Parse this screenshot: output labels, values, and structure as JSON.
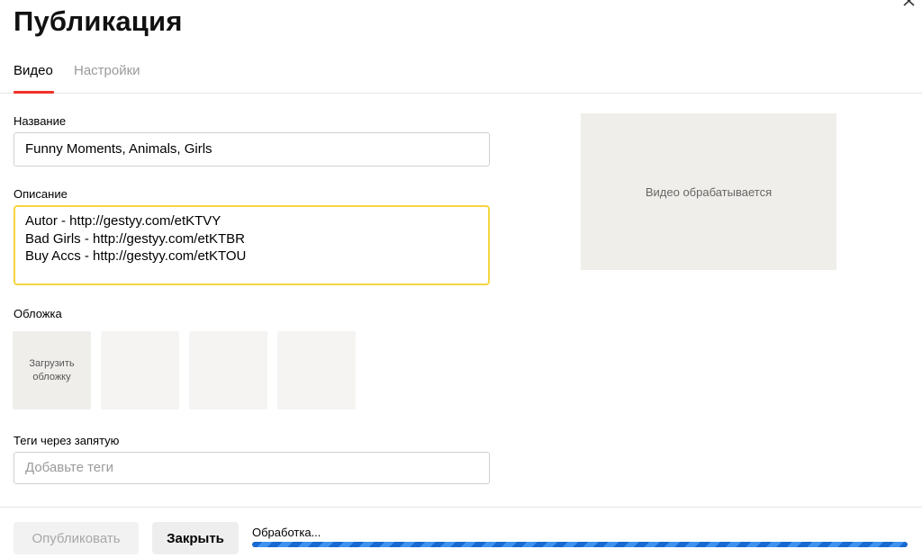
{
  "dialog": {
    "title": "Публикация",
    "close_icon": "close-x-icon"
  },
  "tabs": [
    {
      "label": "Видео",
      "active": true
    },
    {
      "label": "Настройки",
      "active": false
    }
  ],
  "form": {
    "title_label": "Название",
    "title_value": "Funny Moments, Animals, Girls",
    "description_label": "Описание",
    "description_value": "Autor - http://gestyy.com/etKTVY\nBad Girls - http://gestyy.com/etKTBR\nBuy Accs - http://gestyy.com/etKTOU",
    "cover_label": "Обложка",
    "cover_upload_label": "Загрузить обложку",
    "tags_label": "Теги через запятую",
    "tags_placeholder": "Добавьте теги"
  },
  "preview": {
    "status": "Видео обрабатывается"
  },
  "footer": {
    "publish_label": "Опубликовать",
    "close_label": "Закрыть",
    "processing_label": "Обработка...",
    "progress_percent": 100
  },
  "colors": {
    "accent_tab": "#f0322a",
    "focus_border": "#f5d540",
    "progress": "#1a73d9"
  }
}
